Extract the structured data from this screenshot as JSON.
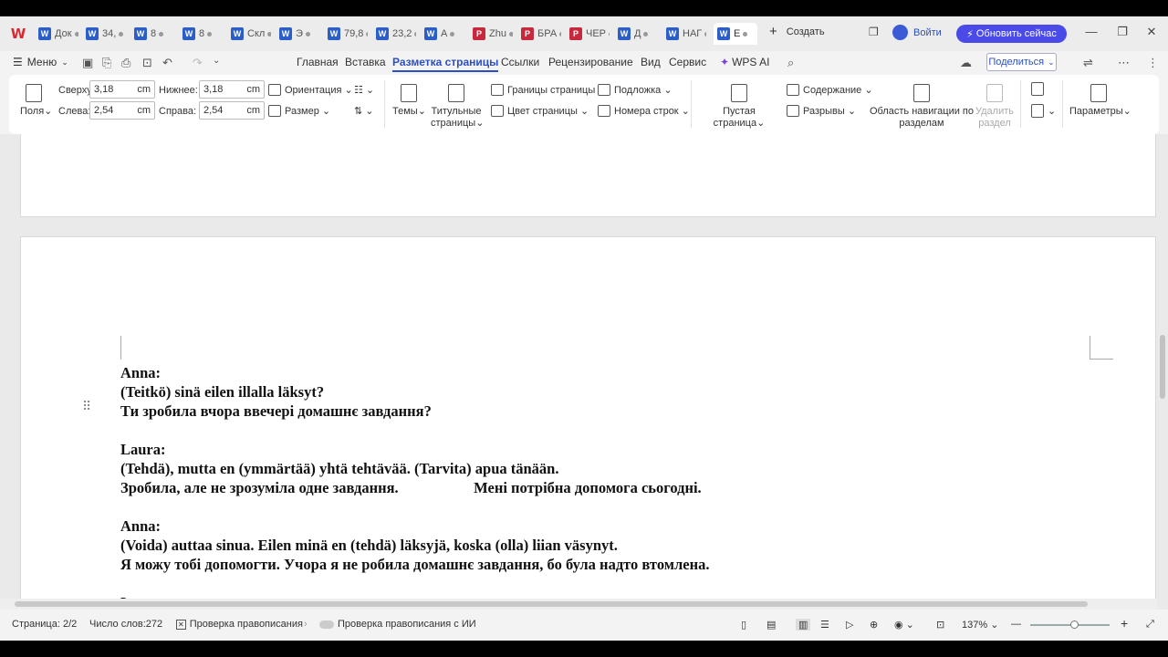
{
  "tabbar": {
    "tabs": [
      {
        "icon": "W",
        "label": "Док"
      },
      {
        "icon": "W",
        "label": "34,"
      },
      {
        "icon": "W",
        "label": "8"
      },
      {
        "icon": "W",
        "label": "8"
      },
      {
        "icon": "W",
        "label": "Скл"
      },
      {
        "icon": "W",
        "label": "Э"
      },
      {
        "icon": "W",
        "label": "79,8"
      },
      {
        "icon": "W",
        "label": "23,2"
      },
      {
        "icon": "W",
        "label": "А"
      },
      {
        "icon": "P",
        "label": "Zhu"
      },
      {
        "icon": "P",
        "label": "БРА"
      },
      {
        "icon": "P",
        "label": "ЧЕР"
      },
      {
        "icon": "W",
        "label": "Д"
      },
      {
        "icon": "W",
        "label": "НАГ"
      },
      {
        "icon": "W",
        "label": "Е"
      }
    ],
    "new_tab": "Создать",
    "login": "Войти",
    "upgrade": "Обновить сейчас"
  },
  "menubar": {
    "menu": "Меню",
    "tabs": [
      "Главная",
      "Вставка",
      "Разметка страницы",
      "Ссылки",
      "Рецензирование",
      "Вид",
      "Сервис",
      "WPS AI"
    ],
    "share": "Поделиться"
  },
  "ribbon": {
    "margins_label": "Поля",
    "top_label": "Сверху:",
    "top_value": "3,18",
    "bottom_label": "Нижнее:",
    "bottom_value": "3,18",
    "left_label": "Слева:",
    "left_value": "2,54",
    "right_label": "Справа:",
    "right_value": "2,54",
    "unit": "cm",
    "orientation": "Ориентация",
    "size": "Размер",
    "themes": "Темы",
    "title_pages_1": "Титульные",
    "title_pages_2": "страницы",
    "page_borders": "Границы страницы",
    "page_color": "Цвет страницы",
    "watermark": "Подложка",
    "line_numbers": "Номера строк",
    "blank_page": "Пустая страница",
    "contents": "Содержание",
    "breaks": "Разрывы",
    "section_nav_1": "Область навигации по",
    "section_nav_2": "разделам",
    "delete_section_1": "Удалить",
    "delete_section_2": "раздел",
    "parameters": "Параметры"
  },
  "document": {
    "lines": [
      "Anna:",
      "(Teitkö) sinä eilen illalla läksyt?",
      "Ти зробила вчора ввечері домашнє завдання?",
      "",
      "Laura:",
      "(Tehdä), mutta en (ymmärtää) yhtä tehtävää. (Tarvita) apua tänään.",
      "Зробила, але не зрозуміла одне завдання.                    Мені потрібна допомога сьогодні.",
      "",
      "Anna:",
      "(Voida) auttaa sinua. Eilen minä en (tehdä) läksyjä, koska (olla) liian väsynyt.",
      "Я можу тобі допомогти. Учора я не робила домашнє завдання, бо була надто втомлена.",
      "",
      "Laura:"
    ]
  },
  "statusbar": {
    "page": "Страница: 2/2",
    "words": "Число слов:272",
    "spellcheck": "Проверка правописания",
    "ai_spellcheck": "Проверка правописания с ИИ",
    "zoom": "137%"
  }
}
